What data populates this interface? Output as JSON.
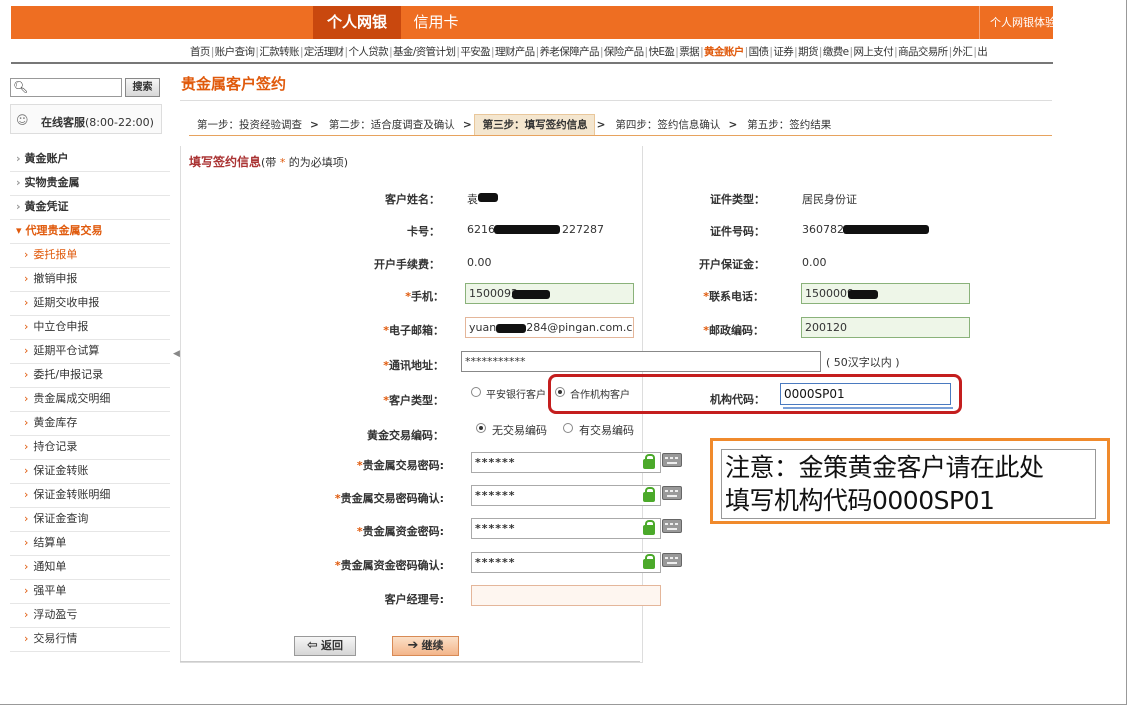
{
  "topbar": {
    "tab_personal": "个人网银",
    "tab_credit": "信用卡",
    "right_text": "个人网银体验"
  },
  "navlinks": [
    "首页",
    "账户查询",
    "汇款转账",
    "定活理财",
    "个人贷款",
    "基金/资管计划",
    "平安盈",
    "理财产品",
    "养老保障产品",
    "保险产品",
    "快E盈",
    "票据",
    "黄金账户",
    "国债",
    "证券",
    "期货",
    "缴费e",
    "网上支付",
    "商品交易所",
    "外汇",
    "出"
  ],
  "nav_highlight_index": 12,
  "search": {
    "button": "搜索"
  },
  "service": {
    "label": "在线客服",
    "hours": "(8:00-22:00)"
  },
  "menu": [
    {
      "label": "黄金账户",
      "level": 1
    },
    {
      "label": "实物贵金属",
      "level": 1
    },
    {
      "label": "黄金凭证",
      "level": 1
    },
    {
      "label": "代理贵金属交易",
      "level": 1,
      "open": true
    },
    {
      "label": "委托报单",
      "level": 2,
      "active": true
    },
    {
      "label": "撤销申报",
      "level": 2
    },
    {
      "label": "延期交收申报",
      "level": 2
    },
    {
      "label": "中立仓申报",
      "level": 2
    },
    {
      "label": "延期平仓试算",
      "level": 2
    },
    {
      "label": "委托/申报记录",
      "level": 2
    },
    {
      "label": "贵金属成交明细",
      "level": 2
    },
    {
      "label": "黄金库存",
      "level": 2
    },
    {
      "label": "持仓记录",
      "level": 2
    },
    {
      "label": "保证金转账",
      "level": 2
    },
    {
      "label": "保证金转账明细",
      "level": 2
    },
    {
      "label": "保证金查询",
      "level": 2
    },
    {
      "label": "结算单",
      "level": 2
    },
    {
      "label": "通知单",
      "level": 2
    },
    {
      "label": "强平单",
      "level": 2
    },
    {
      "label": "浮动盈亏",
      "level": 2
    },
    {
      "label": "交易行情",
      "level": 2
    }
  ],
  "page_title": "贵金属客户签约",
  "steps": [
    {
      "label": "第一步：投资经验调查",
      "current": false
    },
    {
      "label": "第二步：适合度调查及确认",
      "current": false
    },
    {
      "label": "第三步：填写签约信息",
      "current": true
    },
    {
      "label": "第四步：签约信息确认",
      "current": false
    },
    {
      "label": "第五步：签约结果",
      "current": false
    }
  ],
  "form": {
    "subtitle": "填写签约信息",
    "subtitle_note_pre": "(带 ",
    "subtitle_note_star": "*",
    "subtitle_note_post": " 的为必填项)",
    "name_label": "客户姓名：",
    "name_value": "袁",
    "idtype_label": "证件类型：",
    "idtype_value": "居民身份证",
    "card_label": "卡号：",
    "card_value_a": "6216",
    "card_value_b": "227287",
    "idno_label": "证件号码：",
    "idno_value": "360782",
    "fee_label": "开户手续费：",
    "fee_value": "0.00",
    "deposit_label": "开户保证金：",
    "deposit_value": "0.00",
    "mobile_label": "手机：",
    "mobile_value": "1500092",
    "phone_label": "联系电话：",
    "phone_value": "1500009",
    "email_label": "电子邮箱：",
    "email_value_a": "yuan",
    "email_value_b": "284@pingan.com.cn",
    "zip_label": "邮政编码：",
    "zip_value": "200120",
    "address_label": "通讯地址：",
    "address_value": "***********",
    "address_hint": "( 50汉字以内 )",
    "custtype_label": "客户类型：",
    "custtype_opt1": "平安银行客户",
    "custtype_opt2": "合作机构客户",
    "org_label": "机构代码：",
    "org_value": "0000SP01",
    "tradecode_label": "黄金交易编码：",
    "tradecode_opt1": "无交易编码",
    "tradecode_opt2": "有交易编码",
    "tradepwd_label": "贵金属交易密码:",
    "tradepwd_value": "******",
    "tradepwd2_label": "贵金属交易密码确认:",
    "tradepwd2_value": "******",
    "fundpwd_label": "贵金属资金密码:",
    "fundpwd_value": "******",
    "fundpwd2_label": "贵金属资金密码确认:",
    "fundpwd2_value": "******",
    "manager_label": "客户经理号:",
    "manager_value": "",
    "required_mark": "*"
  },
  "buttons": {
    "back": "返回",
    "next": "继续"
  },
  "note": {
    "line1": "注意：金策黄金客户请在此处",
    "line2": "填写机构代码0000SP01"
  },
  "colors": {
    "brand": "#ee6e22",
    "brand_dark": "#c9480e",
    "highlight_box": "#c41e1e",
    "note_border": "#f08a2c"
  }
}
